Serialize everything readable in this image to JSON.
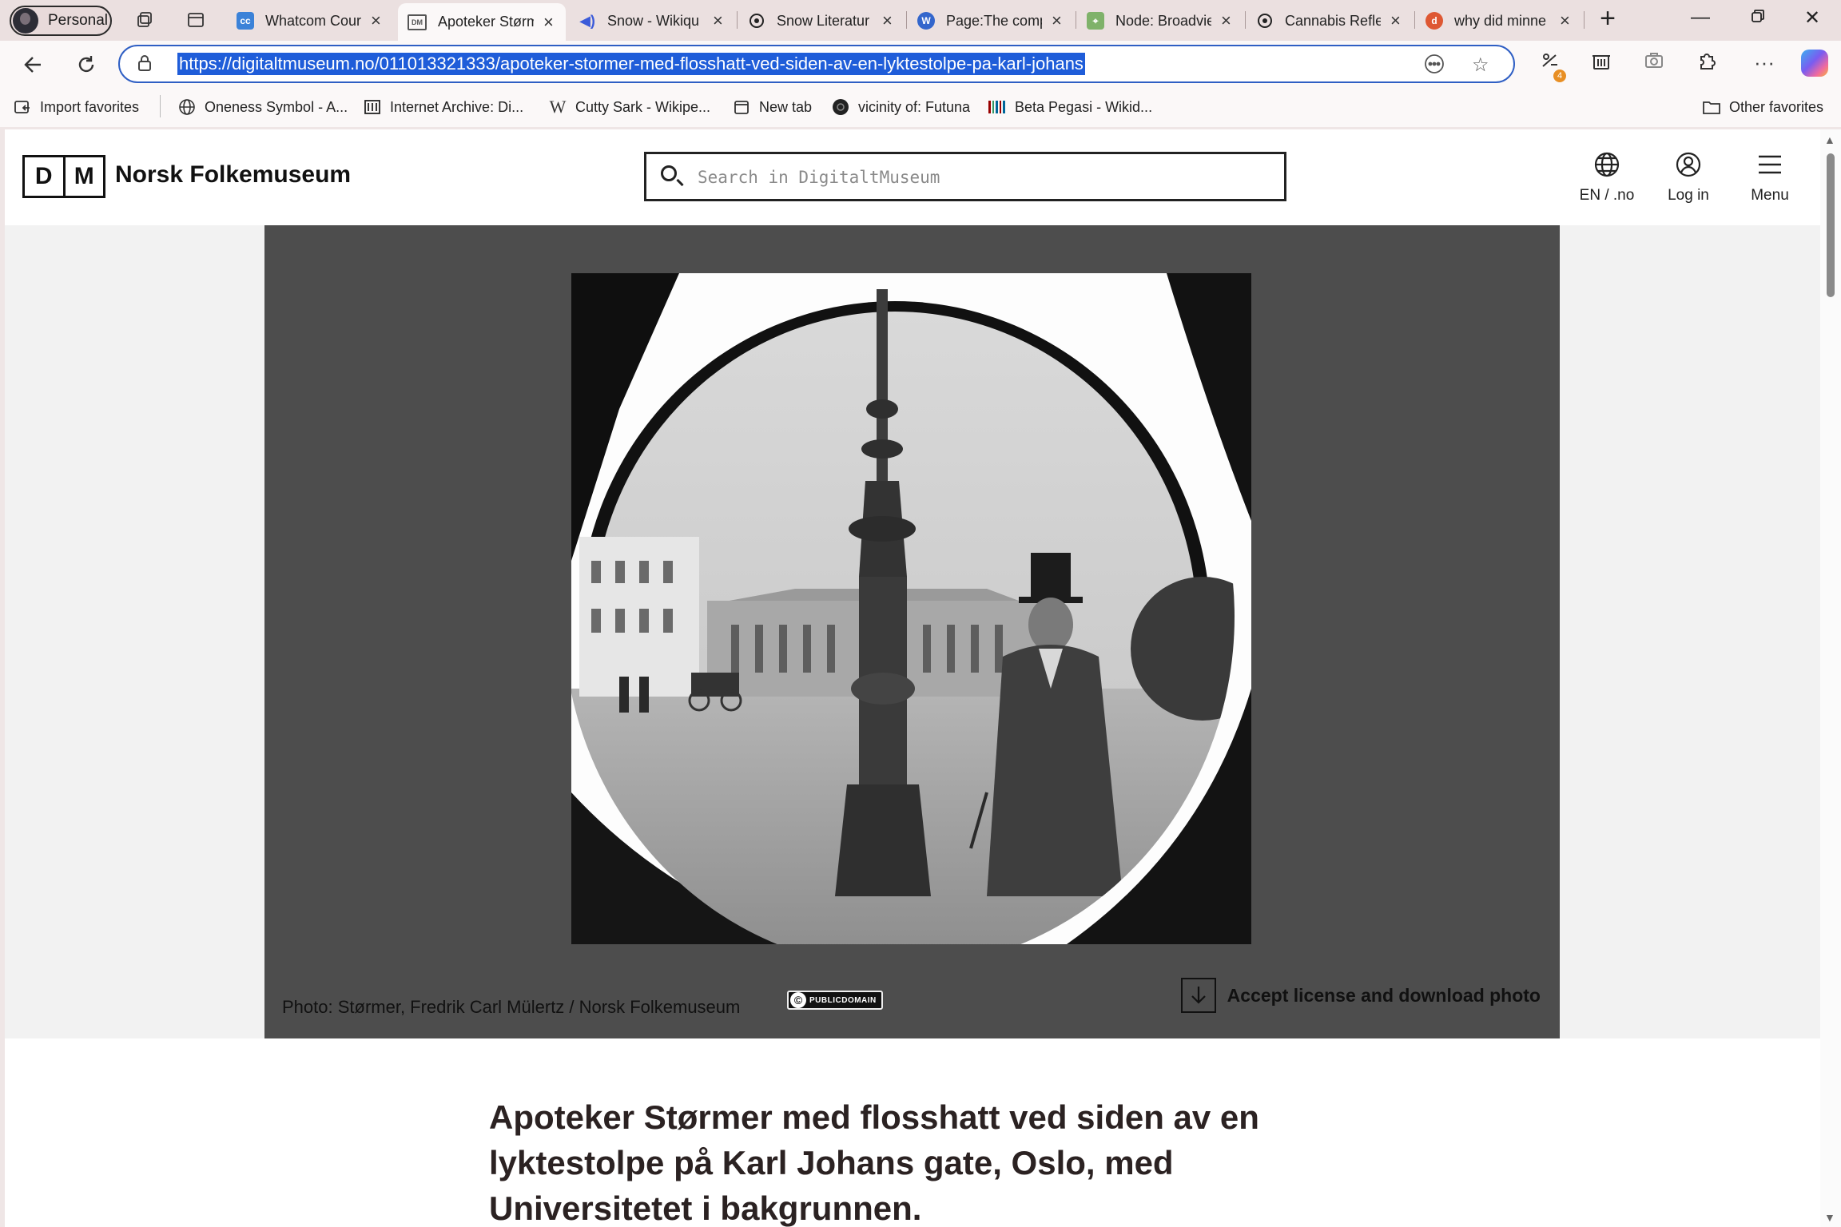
{
  "browser": {
    "profile_label": "Personal",
    "tabs": [
      {
        "title": "Whatcom Cour",
        "favicon": "cc-icon",
        "color": "#3b82d8"
      },
      {
        "title": "Apoteker Størm",
        "favicon": "dm-icon",
        "color": "#555555",
        "active": true
      },
      {
        "title": "Snow - Wikiqu",
        "favicon": "speaker-icon",
        "color": "#3b5bd9"
      },
      {
        "title": "Snow Literatur",
        "favicon": "openai-icon",
        "color": "#222222"
      },
      {
        "title": "Page:The comp",
        "favicon": "wikisource-icon",
        "color": "#3366cc"
      },
      {
        "title": "Node: Broadvie",
        "favicon": "map-icon",
        "color": "#5a9a4a"
      },
      {
        "title": "Cannabis Refle",
        "favicon": "openai-icon",
        "color": "#222222"
      },
      {
        "title": "why did minne",
        "favicon": "duckduckgo-icon",
        "color": "#de5833"
      }
    ],
    "url": "https://digitaltmuseum.no/011013321333/apoteker-stormer-med-flosshatt-ved-siden-av-en-lyktestolpe-pa-karl-johans",
    "extension_badge": "4",
    "favorites": [
      {
        "label": "Import favorites",
        "icon": "import-icon"
      },
      {
        "label": "Oneness Symbol - A...",
        "icon": "globe-icon"
      },
      {
        "label": "Internet Archive: Di...",
        "icon": "archive-icon"
      },
      {
        "label": "Cutty Sark - Wikipe...",
        "icon": "wikipedia-icon"
      },
      {
        "label": "New tab",
        "icon": "newtab-icon"
      },
      {
        "label": "vicinity of: Futuna",
        "icon": "dark-circle-icon"
      },
      {
        "label": "Beta Pegasi - Wikid...",
        "icon": "wikidata-icon"
      }
    ],
    "other_favorites": "Other favorites"
  },
  "site": {
    "logo_letters": [
      "D",
      "M"
    ],
    "name": "Norsk Folkemuseum",
    "search_placeholder": "Search in DigitaltMuseum",
    "language": "EN / .no",
    "login": "Log in",
    "menu": "Menu"
  },
  "viewer": {
    "caption": "Photo: Størmer, Fredrik Carl Mülertz / Norsk Folkemuseum",
    "license_badge": "PUBLICDOMAIN",
    "download_label": "Accept license and download photo"
  },
  "object": {
    "title": "Apoteker Størmer med flosshatt ved siden av en lyktestolpe på Karl Johans gate, Oslo, med Universitetet i bakgrunnen."
  },
  "colors": {
    "url_highlight": "#1f5dd9",
    "viewer_bg": "#4d4d4d",
    "title_text": "#2b2222"
  }
}
